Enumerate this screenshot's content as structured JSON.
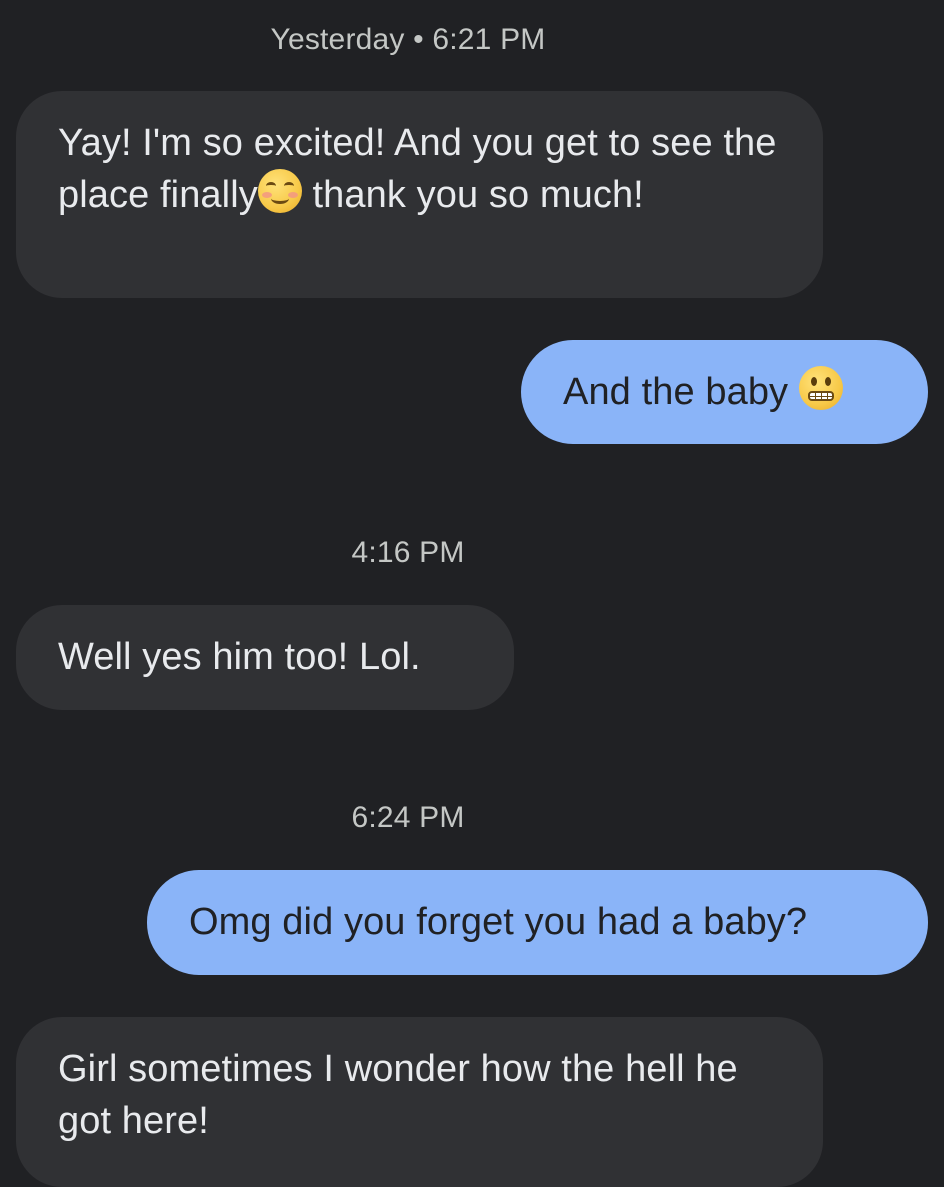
{
  "colors": {
    "background": "#202124",
    "incoming_bubble": "#303134",
    "outgoing_bubble": "#8ab4f8",
    "incoming_text": "#e8eaed",
    "outgoing_text": "#202124",
    "timestamp_text": "#c4c7c5"
  },
  "conversation": {
    "timestamps": [
      "Yesterday • 6:21 PM",
      "4:16 PM",
      "6:24 PM"
    ],
    "messages": [
      {
        "direction": "incoming",
        "text_before_emoji": "Yay! I'm so excited! And you get to see the place finally",
        "emoji": "smiling-face-with-blush-emoji",
        "text_after_emoji": " thank you so much!"
      },
      {
        "direction": "outgoing",
        "text": "And the baby ",
        "emoji": "grimacing-face-emoji"
      },
      {
        "direction": "incoming",
        "text": "Well yes him too! Lol."
      },
      {
        "direction": "outgoing",
        "text": "Omg did you forget you had a baby?"
      },
      {
        "direction": "incoming",
        "text": "Girl sometimes I wonder how the hell he got here!"
      }
    ]
  }
}
